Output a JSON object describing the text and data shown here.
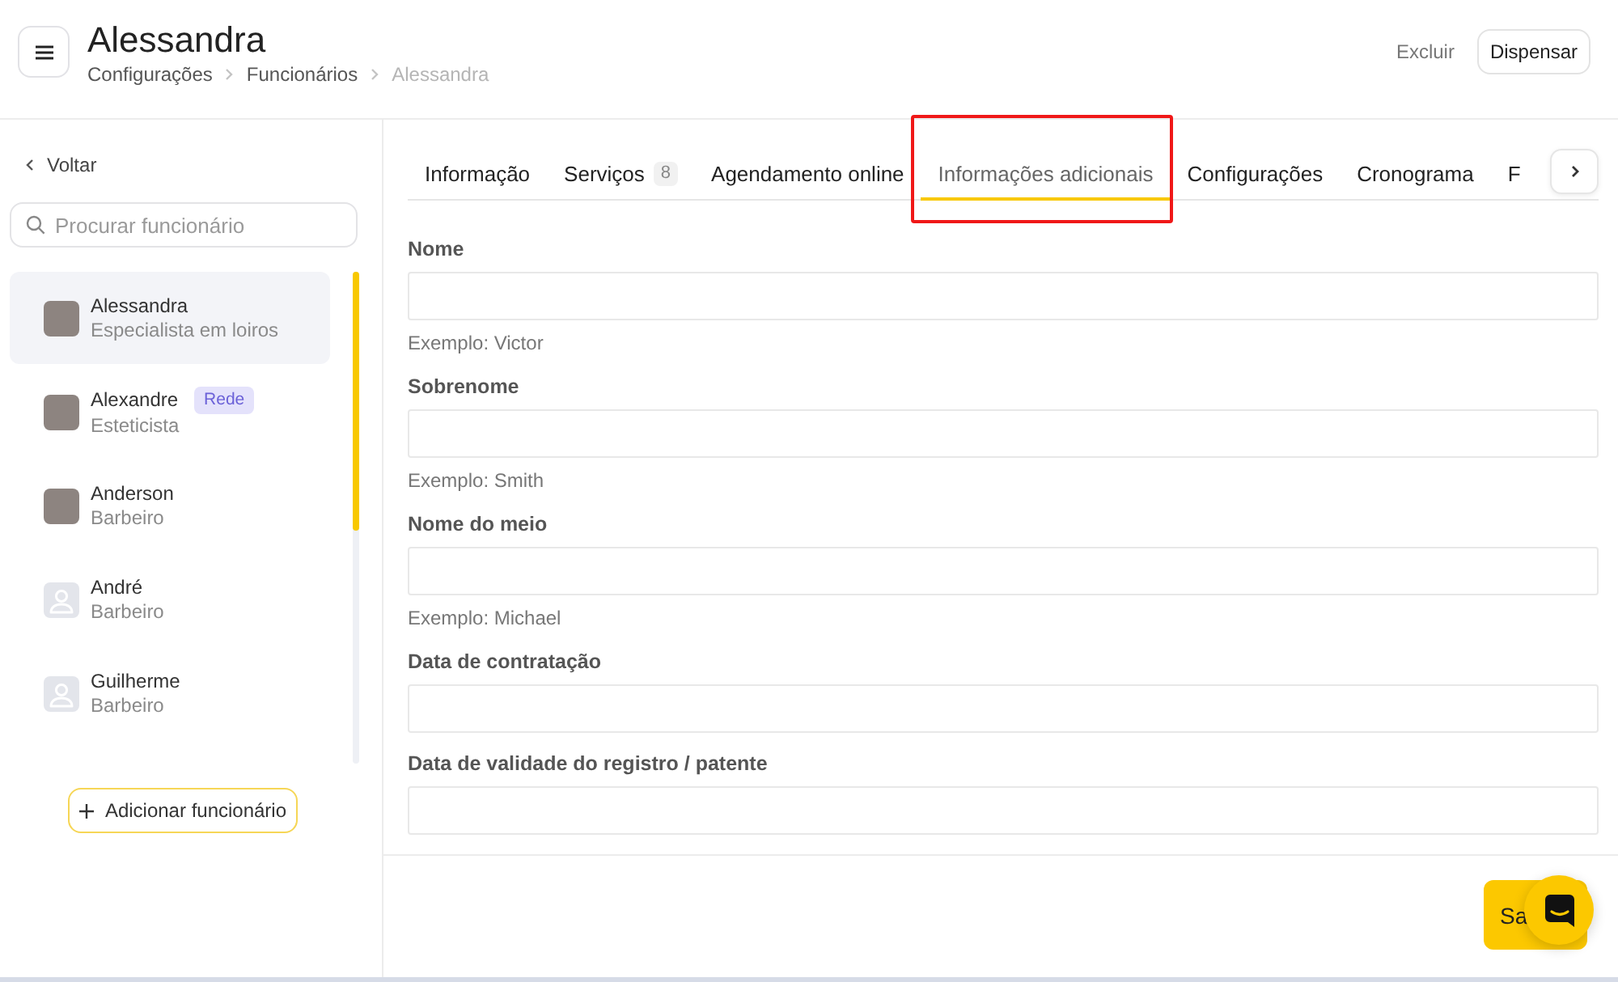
{
  "header": {
    "title": "Alessandra",
    "breadcrumb": [
      {
        "label": "Configurações",
        "current": false
      },
      {
        "label": "Funcionários",
        "current": false
      },
      {
        "label": "Alessandra",
        "current": true
      }
    ],
    "actions": [
      {
        "label": "Excluir",
        "kind": "link"
      },
      {
        "label": "Dispensar",
        "kind": "outlined"
      }
    ]
  },
  "sidebar": {
    "back_label": "Voltar",
    "search": {
      "placeholder": "Procurar funcionário"
    },
    "employees": [
      {
        "kind": "photo",
        "name": "Alessandra",
        "role": "Especialista em loiros",
        "selected": true
      },
      {
        "kind": "photo",
        "name": "Alexandre",
        "role": "Esteticista",
        "selected": false,
        "badge": "Rede"
      },
      {
        "kind": "photo",
        "name": "Anderson",
        "role": "Barbeiro",
        "selected": false
      },
      {
        "kind": "placeholder",
        "name": "André",
        "role": "Barbeiro",
        "selected": false
      },
      {
        "kind": "placeholder",
        "name": "Guilherme",
        "role": "Barbeiro",
        "selected": false
      }
    ],
    "add_button": "Adicionar funcionário"
  },
  "tabs": [
    {
      "label": "Informação",
      "selected": false,
      "highlighted": false
    },
    {
      "label": "Serviços",
      "count": "8",
      "selected": false,
      "highlighted": false
    },
    {
      "label": "Agendamento online",
      "selected": false,
      "highlighted": false
    },
    {
      "label": "Informações adicionais",
      "selected": true,
      "highlighted": true
    },
    {
      "label": "Configurações",
      "selected": false,
      "highlighted": false
    },
    {
      "label": "Cronograma",
      "selected": false,
      "highlighted": false
    },
    {
      "label": "F",
      "selected": false,
      "highlighted": false
    }
  ],
  "form": {
    "fields": [
      {
        "label": "Nome",
        "hint": "Exemplo: Victor"
      },
      {
        "label": "Sobrenome",
        "hint": "Exemplo: Smith"
      },
      {
        "label": "Nome do meio",
        "hint": "Exemplo: Michael"
      },
      {
        "label": "Data de contratação"
      },
      {
        "label": "Data de validade do registro / patente"
      }
    ]
  },
  "footer": {
    "save_button": "Sa"
  }
}
